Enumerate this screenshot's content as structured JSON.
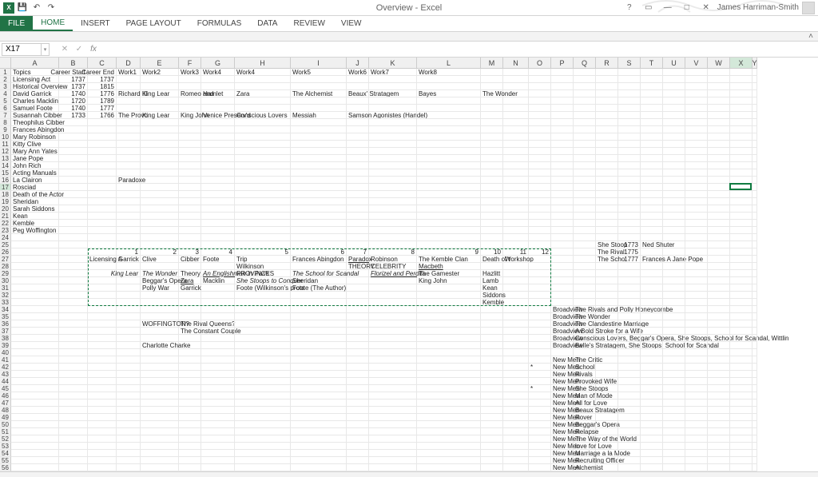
{
  "app": {
    "title": "Overview - Excel",
    "user": "James Harriman-Smith"
  },
  "tabs": [
    "FILE",
    "HOME",
    "INSERT",
    "PAGE LAYOUT",
    "FORMULAS",
    "DATA",
    "REVIEW",
    "VIEW"
  ],
  "activeTab": "HOME",
  "namebox": "X17",
  "columns": [
    {
      "l": "A",
      "w": 60
    },
    {
      "l": "B",
      "w": 36
    },
    {
      "l": "C",
      "w": 36
    },
    {
      "l": "D",
      "w": 30
    },
    {
      "l": "E",
      "w": 48
    },
    {
      "l": "F",
      "w": 28
    },
    {
      "l": "G",
      "w": 42
    },
    {
      "l": "H",
      "w": 70
    },
    {
      "l": "I",
      "w": 70
    },
    {
      "l": "J",
      "w": 28
    },
    {
      "l": "K",
      "w": 60
    },
    {
      "l": "L",
      "w": 80
    },
    {
      "l": "M",
      "w": 28
    },
    {
      "l": "N",
      "w": 32
    },
    {
      "l": "O",
      "w": 28
    },
    {
      "l": "P",
      "w": 28
    },
    {
      "l": "Q",
      "w": 28
    },
    {
      "l": "R",
      "w": 28
    },
    {
      "l": "S",
      "w": 28
    },
    {
      "l": "T",
      "w": 28
    },
    {
      "l": "U",
      "w": 28
    },
    {
      "l": "V",
      "w": 28
    },
    {
      "l": "W",
      "w": 28
    },
    {
      "l": "X",
      "w": 28
    },
    {
      "l": "Y",
      "w": 6
    }
  ],
  "rows": [
    {
      "n": 1,
      "c": {
        "A": "Topics",
        "B": {
          "t": "Career Start",
          "a": "r"
        },
        "C": {
          "t": "Career End",
          "a": "r"
        },
        "D": "Work1",
        "E": "Work2",
        "F": "Work3",
        "G": "Work4",
        "H": "Work4",
        "I": "Work5",
        "J": "Work6",
        "K": "Work7",
        "L": "Work8"
      }
    },
    {
      "n": 2,
      "c": {
        "A": "Licensing Act",
        "B": {
          "t": "1737",
          "a": "r"
        },
        "C": {
          "t": "1737",
          "a": "r"
        }
      }
    },
    {
      "n": 3,
      "c": {
        "A": "Historical Overview",
        "B": {
          "t": "1737",
          "a": "r"
        },
        "C": {
          "t": "1815",
          "a": "r"
        }
      }
    },
    {
      "n": 4,
      "c": {
        "A": "David Garrick",
        "B": {
          "t": "1740",
          "a": "r"
        },
        "C": {
          "t": "1776",
          "a": "r"
        },
        "D": "Richard III",
        "E": "King Lear",
        "F": "Romeo and",
        "G": "Hamlet",
        "H": "Zara",
        "I": "The Alchemist",
        "J": "Beaux' Stratagem",
        "L": "Bayes",
        "M": "The Wonder"
      }
    },
    {
      "n": 5,
      "c": {
        "A": "Charles Macklin",
        "B": {
          "t": "1720",
          "a": "r"
        },
        "C": {
          "t": "1789",
          "a": "r"
        }
      }
    },
    {
      "n": 6,
      "c": {
        "A": "Samuel Foote",
        "B": {
          "t": "1740",
          "a": "r"
        },
        "C": {
          "t": "1777",
          "a": "r"
        }
      }
    },
    {
      "n": 7,
      "c": {
        "A": "Susannah Cibber",
        "B": {
          "t": "1733",
          "a": "r"
        },
        "C": {
          "t": "1766",
          "a": "r"
        },
        "D": "The Provo",
        "E": "King Lear",
        "F": "King John",
        "G": "Venice Preserv'd",
        "H": "Conscious Lovers",
        "I": "Messiah",
        "J": "Samson Agonistes (Handel)"
      }
    },
    {
      "n": 8,
      "c": {
        "A": "Theophilus Cibber"
      }
    },
    {
      "n": 9,
      "c": {
        "A": "Frances Abingdon"
      }
    },
    {
      "n": 10,
      "c": {
        "A": "Mary Robinson"
      }
    },
    {
      "n": 11,
      "c": {
        "A": "Kitty Clive"
      }
    },
    {
      "n": 12,
      "c": {
        "A": "Mary Ann Yates"
      }
    },
    {
      "n": 13,
      "c": {
        "A": "Jane Pope"
      }
    },
    {
      "n": 14,
      "c": {
        "A": "John Rich"
      }
    },
    {
      "n": 15,
      "c": {
        "A": "Acting Manuals"
      }
    },
    {
      "n": 16,
      "c": {
        "A": "La Clairon",
        "D": "Paradoxe"
      }
    },
    {
      "n": 17,
      "c": {
        "A": "Rosciad"
      }
    },
    {
      "n": 18,
      "c": {
        "A": "Death of the Actor"
      }
    },
    {
      "n": 19,
      "c": {
        "A": "Sheridan"
      }
    },
    {
      "n": 20,
      "c": {
        "A": "Sarah Siddons"
      }
    },
    {
      "n": 21,
      "c": {
        "A": "Kean"
      }
    },
    {
      "n": 22,
      "c": {
        "A": "Kemble"
      }
    },
    {
      "n": 23,
      "c": {
        "A": "Peg Woffington"
      }
    },
    {
      "n": 24,
      "c": {}
    },
    {
      "n": 25,
      "c": {
        "R": "She Stoop",
        "S": {
          "t": "1773",
          "a": "r"
        },
        "T": "Ned Shuter"
      }
    },
    {
      "n": 26,
      "c": {
        "D": {
          "t": "1",
          "a": "r"
        },
        "E": {
          "t": "2",
          "a": "r"
        },
        "F": {
          "t": "3",
          "a": "r"
        },
        "G": {
          "t": "4",
          "a": "r"
        },
        "H": {
          "t": "5",
          "a": "r"
        },
        "I": {
          "t": "6",
          "a": "r"
        },
        "J": {
          "t": "7",
          "a": "r"
        },
        "K": {
          "t": "8",
          "a": "r"
        },
        "L": {
          "t": "9",
          "a": "r"
        },
        "M": {
          "t": "10",
          "a": "r"
        },
        "N": {
          "t": "11",
          "a": "r"
        },
        "O": {
          "t": "12",
          "a": "r"
        },
        "R": "The Rival",
        "S": {
          "t": "1775",
          "a": "r"
        }
      }
    },
    {
      "n": 27,
      "c": {
        "C": "Licensing A",
        "D": "Garrick",
        "E": "Clive",
        "F": "Cibber",
        "G": "Foote",
        "H": "Trip",
        "I": "Frances Abingdon",
        "J": {
          "t": "Paradox",
          "s": "u"
        },
        "K": "Robinson",
        "L": "The Kemble Clan",
        "M": "Death of t",
        "N": "Workshop",
        "R": "The Scho",
        "S": {
          "t": "1777",
          "a": "r"
        },
        "T": "Frances A Jane Pope"
      }
    },
    {
      "n": 28,
      "c": {
        "H": "Wilkinson",
        "J": "THEORY",
        "K": "CELEBRITY",
        "L": {
          "t": "Macbeth",
          "s": "u"
        }
      }
    },
    {
      "n": 29,
      "c": {
        "D": {
          "t": "King Lear",
          "s": "i",
          "a": "r"
        },
        "E": {
          "t": "The Wonder",
          "s": "i"
        },
        "F": "Theory",
        "G": {
          "t": "An Englishman in Paris",
          "s": "iu"
        },
        "H": "PROVINCES",
        "I": {
          "t": "The School for Scandal",
          "s": "i"
        },
        "K": {
          "t": "Florizel and Perdita",
          "s": "iu"
        },
        "L": "The Gamester",
        "M": "Hazlitt"
      }
    },
    {
      "n": 30,
      "c": {
        "E": "Beggar's Opera",
        "F": {
          "t": "Zara",
          "s": "u"
        },
        "G": "Macklin",
        "H": {
          "t": "She Stoops to Conquer",
          "s": "i"
        },
        "I": "Sheridan",
        "L": "King John",
        "M": "Lamb"
      }
    },
    {
      "n": 31,
      "c": {
        "E": "Polly War",
        "F": "Garrick",
        "H": "Foote (Wilkinson's prote",
        "I": "Foote (The Author)",
        "M": "Kean"
      }
    },
    {
      "n": 32,
      "c": {
        "M": "Siddons"
      }
    },
    {
      "n": 33,
      "c": {
        "M": "Kemble"
      }
    },
    {
      "n": 34,
      "c": {
        "P": "Broadview",
        "Q": "The Rivals and Polly Honeycombe"
      }
    },
    {
      "n": 35,
      "c": {
        "P": "Broadview",
        "Q": "The Wonder"
      }
    },
    {
      "n": 36,
      "c": {
        "E": "WOFFINGTON?",
        "F": "The Rival Queens?",
        "P": "Broadview",
        "Q": "The Clandestine Marriage"
      }
    },
    {
      "n": 37,
      "c": {
        "F": "The Constant Couple",
        "P": "Broadview",
        "Q": "A Bold Stroke for a Wife"
      }
    },
    {
      "n": 38,
      "c": {
        "P": "Broadview",
        "Q": "Conscious Lovers, Beggar's Opera, She Stoops, School for Scandal, Wittlin"
      }
    },
    {
      "n": 39,
      "c": {
        "E": "Charlotte Charke",
        "P": "Broadview",
        "Q": "Belle's Stratagem, She Stoops, School for Scandal"
      }
    },
    {
      "n": 40,
      "c": {}
    },
    {
      "n": 41,
      "c": {
        "P": "New Men",
        "Q": "The Critic"
      }
    },
    {
      "n": 42,
      "c": {
        "O": "*",
        "P": "New Men",
        "Q": "School"
      }
    },
    {
      "n": 43,
      "c": {
        "P": "New Men",
        "Q": "Rivals"
      }
    },
    {
      "n": 44,
      "c": {
        "P": "New Men",
        "Q": "Provoked Wife"
      }
    },
    {
      "n": 45,
      "c": {
        "O": "*",
        "P": "New Men",
        "Q": "She Stoops"
      }
    },
    {
      "n": 46,
      "c": {
        "P": "New Men",
        "Q": "Man of Mode"
      }
    },
    {
      "n": 47,
      "c": {
        "P": "New Men",
        "Q": "All for Love"
      }
    },
    {
      "n": 48,
      "c": {
        "P": "New Men",
        "Q": "Beaux Stratagem"
      }
    },
    {
      "n": 49,
      "c": {
        "P": "New Men",
        "Q": "Rover"
      }
    },
    {
      "n": 50,
      "c": {
        "P": "New Men",
        "Q": "Beggar's Opera"
      }
    },
    {
      "n": 51,
      "c": {
        "P": "New Men",
        "Q": "Relapse"
      }
    },
    {
      "n": 52,
      "c": {
        "P": "New Men",
        "Q": "The Way of the World"
      }
    },
    {
      "n": 53,
      "c": {
        "P": "New Men",
        "Q": "love for Love"
      }
    },
    {
      "n": 54,
      "c": {
        "P": "New Men",
        "Q": "Marriage a la Mode"
      }
    },
    {
      "n": 55,
      "c": {
        "P": "New Men",
        "Q": "Recruiting Officer"
      }
    },
    {
      "n": 56,
      "c": {
        "P": "New Men",
        "Q": "Alchemist"
      }
    }
  ],
  "selection": {
    "col": "X",
    "row": 17
  },
  "marquee": {
    "c1": "C",
    "r1": 26,
    "c2": "O",
    "r2": 33
  }
}
